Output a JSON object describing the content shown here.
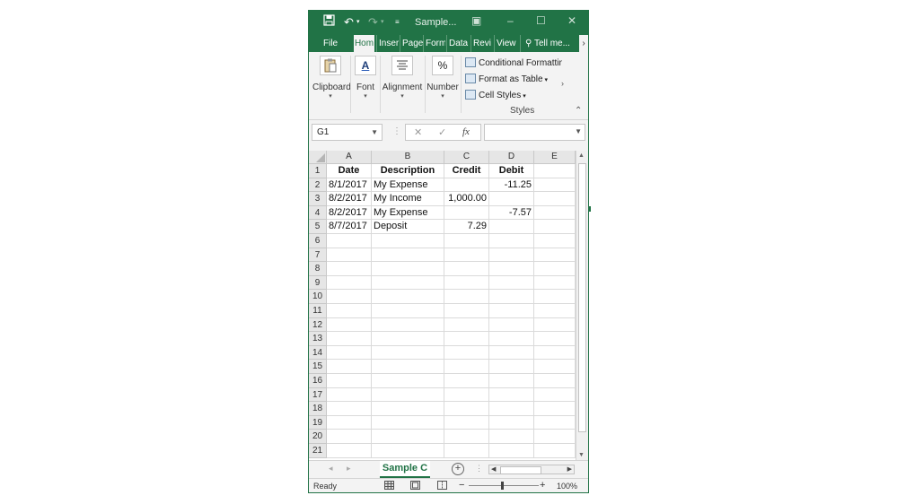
{
  "titlebar": {
    "save_icon": "save-icon",
    "undo_icon": "undo-icon",
    "redo_icon": "redo-icon",
    "customize_icon": "customize-qat-icon",
    "title": "Sample...",
    "ribbon_display_icon": "ribbon-display-icon",
    "minimize_icon": "minimize-icon",
    "maximize_icon": "maximize-icon",
    "close_icon": "close-icon"
  },
  "tabs": {
    "file": "File",
    "home": "Hom",
    "insert": "Inser",
    "page": "Page",
    "formulas": "Form",
    "data": "Data",
    "review": "Revi",
    "view": "View",
    "tell": "Tell me...",
    "more": "›"
  },
  "ribbon": {
    "clipboard": "Clipboard",
    "font": "Font",
    "alignment": "Alignment",
    "number": "Number",
    "number_glyph": "%",
    "font_glyph": "A",
    "conditional": "Conditional Formattin",
    "format_table": "Format as Table",
    "cell_styles": "Cell Styles",
    "styles_group": "Styles"
  },
  "formula_bar": {
    "name_box": "G1",
    "fx": "fx",
    "value": ""
  },
  "columns": [
    "A",
    "B",
    "C",
    "D",
    "E"
  ],
  "rows": [
    "1",
    "2",
    "3",
    "4",
    "5",
    "6",
    "7",
    "8",
    "9",
    "10",
    "11",
    "12",
    "13",
    "14",
    "15",
    "16",
    "17",
    "18",
    "19",
    "20",
    "21"
  ],
  "cells": {
    "r1": {
      "a": "Date",
      "b": "Description",
      "c": "Credit",
      "d": "Debit"
    },
    "r2": {
      "a": "8/1/2017",
      "b": "My Expense",
      "c": "",
      "d": "-11.25"
    },
    "r3": {
      "a": "8/2/2017",
      "b": "My Income",
      "c": "1,000.00",
      "d": ""
    },
    "r4": {
      "a": "8/2/2017",
      "b": "My Expense",
      "c": "",
      "d": "-7.57"
    },
    "r5": {
      "a": "8/7/2017",
      "b": "Deposit",
      "c": "7.29",
      "d": ""
    }
  },
  "sheet_tab": "Sample C",
  "status": {
    "ready": "Ready",
    "zoom": "100%",
    "minus": "−",
    "plus": "+"
  },
  "colors": {
    "accent": "#217346"
  }
}
